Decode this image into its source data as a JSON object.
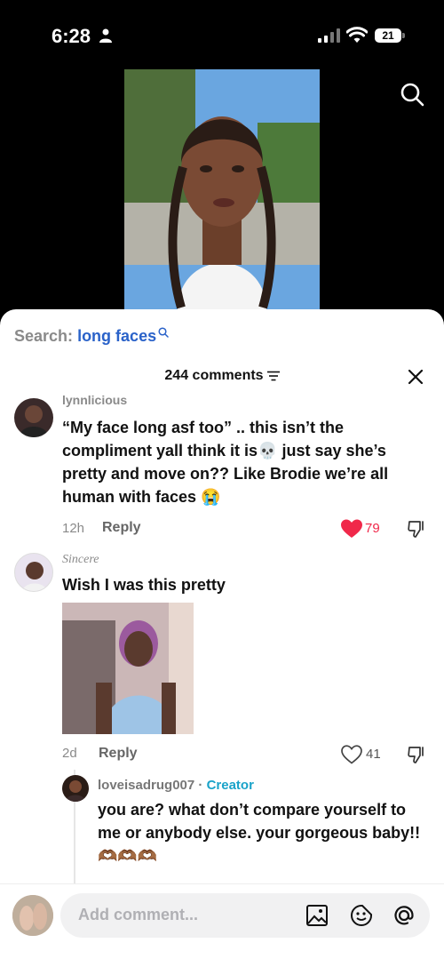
{
  "status": {
    "time": "6:28",
    "battery": "21"
  },
  "search_bar": {
    "label": "Search:",
    "term": "long faces"
  },
  "comments": {
    "count_label": "244 comments"
  },
  "comment1": {
    "username": "lynnlicious",
    "text": "“My face long asf too” .. this isn’t the compliment yall think it is💀 just say she’s pretty and move on?? Like Brodie we’re all human with faces 😭",
    "time": "12h",
    "reply_label": "Reply",
    "likes": "79",
    "liked": true
  },
  "comment2": {
    "username": "Sincere",
    "text": "Wish I was this pretty",
    "time": "2d",
    "reply_label": "Reply",
    "likes": "41",
    "liked": false
  },
  "reply1": {
    "username": "loveisadrug007",
    "separator": "·",
    "tag": "Creator",
    "text": "you are? what don’t compare yourself to me or anybody else. your gorgeous baby!!🫶🏾🫶🏾🫶🏾"
  },
  "composer": {
    "placeholder": "Add comment..."
  },
  "colors": {
    "accent_blue": "#2a62c9",
    "like_red": "#f0284a",
    "creator_cyan": "#1aa3c9"
  },
  "icons": [
    "person-icon",
    "signal-icon",
    "wifi-icon",
    "battery-icon",
    "search-icon",
    "filter-icon",
    "close-icon",
    "heart-icon",
    "dislike-icon",
    "image-icon",
    "sticker-icon",
    "mention-icon"
  ]
}
